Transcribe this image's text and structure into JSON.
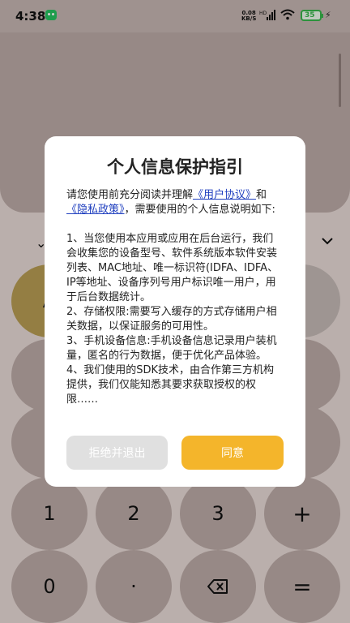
{
  "status_bar": {
    "time": "4:38",
    "net_speed": "0.08",
    "net_unit": "KB/S",
    "hd": "HD",
    "battery": "35"
  },
  "calculator": {
    "visible_keys": [
      "A",
      "1",
      "2",
      "3",
      "+",
      "0",
      "·",
      "="
    ],
    "accent_color": "#c9a85c"
  },
  "dialog": {
    "title": "个人信息保护指引",
    "intro_prefix": "请您使用前充分阅读并理解",
    "link_user": "《用户协议》",
    "intro_and": "和",
    "link_privacy": "《隐私政策》",
    "intro_suffix": "，需要使用的个人信息说明如下:",
    "item1": "1、当您使用本应用或应用在后台运行，我们会收集您的设备型号、软件系统版本软件安装列表、MAC地址、唯一标识符(IDFA、IDFA、IP等地址、设备序列号用户标识唯一用户，用于后台数据统计。",
    "item2": "2、存储权限:需要写入缓存的方式存储用户相关数据，以保证服务的可用性。",
    "item3": "3、手机设备信息:手机设备信息记录用户装机量，匿名的行为数据，便于优化产品体验。",
    "item4": "4、我们使用的SDK技术，由合作第三方机构提供，我们仅能知悉其要求获取授权的权限……",
    "reject_label": "拒绝并退出",
    "agree_label": "同意",
    "agree_color": "#f4b52b"
  }
}
